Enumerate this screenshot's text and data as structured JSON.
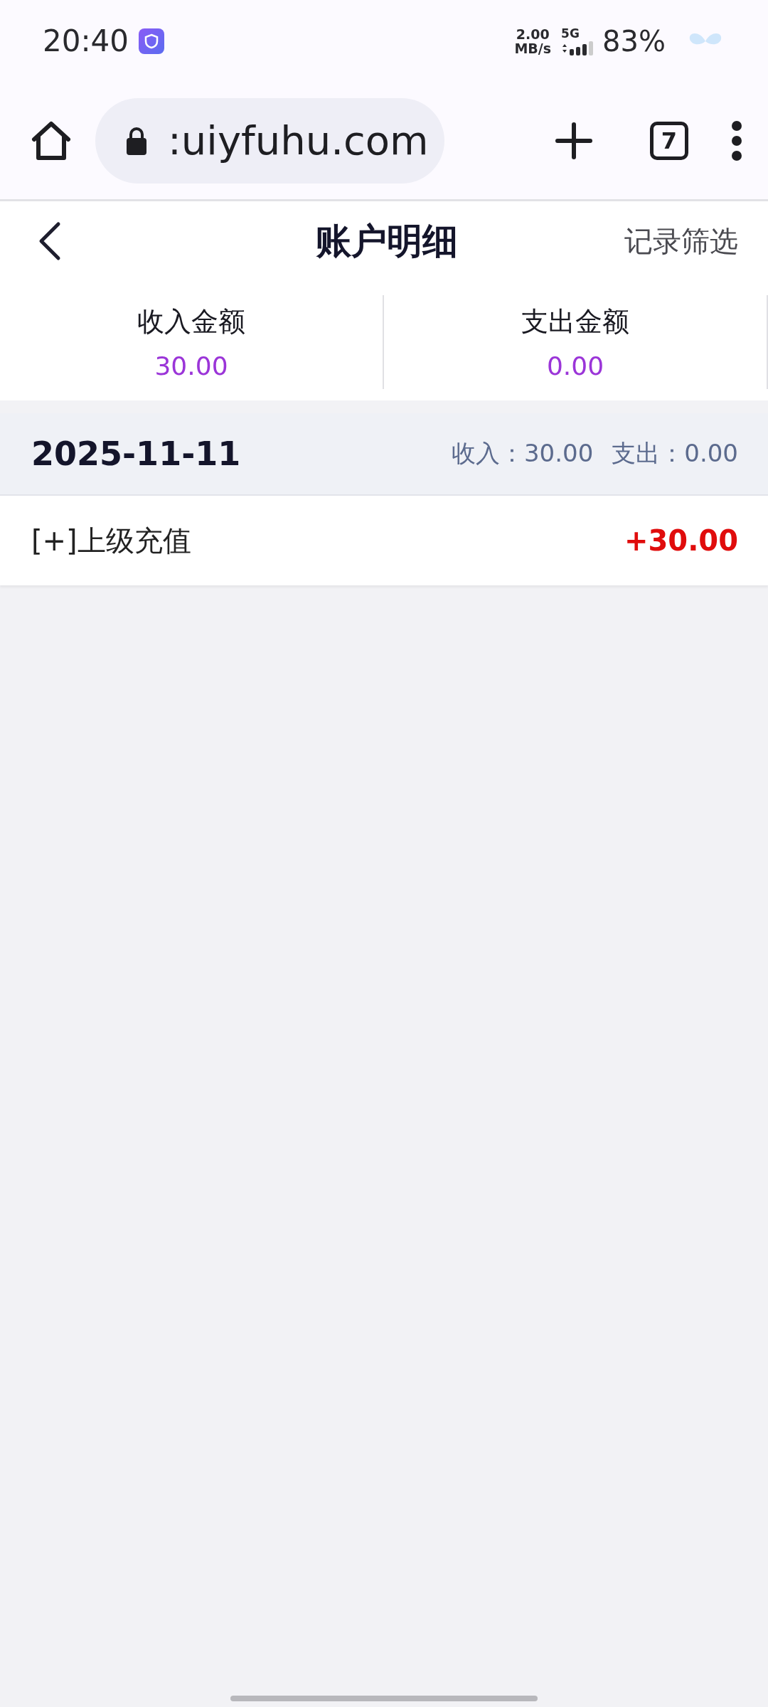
{
  "status_bar": {
    "time": "20:40",
    "speed": "2.00",
    "speed_unit": "MB/s",
    "network": "5G",
    "battery": "83%"
  },
  "browser": {
    "url": ":uiyfuhu.com",
    "tab_count": "7"
  },
  "header": {
    "title": "账户明细",
    "action": "记录筛选"
  },
  "summary": [
    {
      "label": "收入金额",
      "value": "30.00"
    },
    {
      "label": "支出金额",
      "value": "0.00"
    }
  ],
  "groups": [
    {
      "date": "2025-11-11",
      "income": "收入：30.00",
      "expense": "支出：0.00",
      "records": [
        {
          "title": "[+]上级充值",
          "amount": "+30.00",
          "kind": "income"
        }
      ]
    }
  ]
}
